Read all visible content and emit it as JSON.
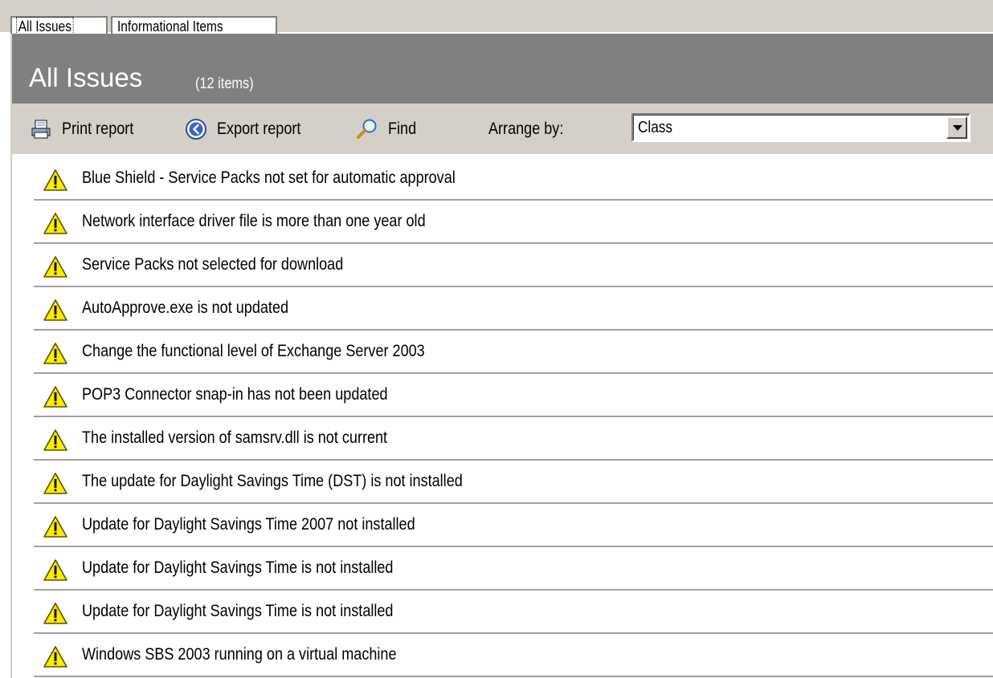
{
  "tabs": [
    {
      "label": "All Issues",
      "active": true
    },
    {
      "label": "Informational Items",
      "active": false
    }
  ],
  "header": {
    "title": "All Issues",
    "count": "(12 items)"
  },
  "toolbar": {
    "print_label": "Print report",
    "export_label": "Export report",
    "find_label": "Find",
    "arrange_label": "Arrange by:",
    "arrange_value": "Class"
  },
  "issues": [
    {
      "label": "Blue Shield - Service Packs not set for automatic approval",
      "icon": "warning-icon"
    },
    {
      "label": "Network interface driver file is more than one year old",
      "icon": "warning-icon"
    },
    {
      "label": "Service Packs not selected for download",
      "icon": "warning-icon"
    },
    {
      "label": "AutoApprove.exe is not updated",
      "icon": "warning-icon"
    },
    {
      "label": "Change the functional level of Exchange Server 2003",
      "icon": "warning-icon"
    },
    {
      "label": "POP3 Connector snap-in has not been updated",
      "icon": "warning-icon"
    },
    {
      "label": "The installed version of samsrv.dll is not current",
      "icon": "warning-icon"
    },
    {
      "label": "The update for Daylight Savings Time (DST) is not installed",
      "icon": "warning-icon"
    },
    {
      "label": "Update for Daylight Savings Time 2007 not installed",
      "icon": "warning-icon"
    },
    {
      "label": "Update for Daylight Savings Time is not installed",
      "icon": "warning-icon"
    },
    {
      "label": "Update for Daylight Savings Time is not installed",
      "icon": "warning-icon"
    },
    {
      "label": "Windows SBS 2003 running on a virtual machine",
      "icon": "warning-icon"
    }
  ],
  "colors": {
    "header_bg": "#808080",
    "toolbar_bg": "#d4d0c8",
    "warning_yellow": "#ffeb00"
  }
}
